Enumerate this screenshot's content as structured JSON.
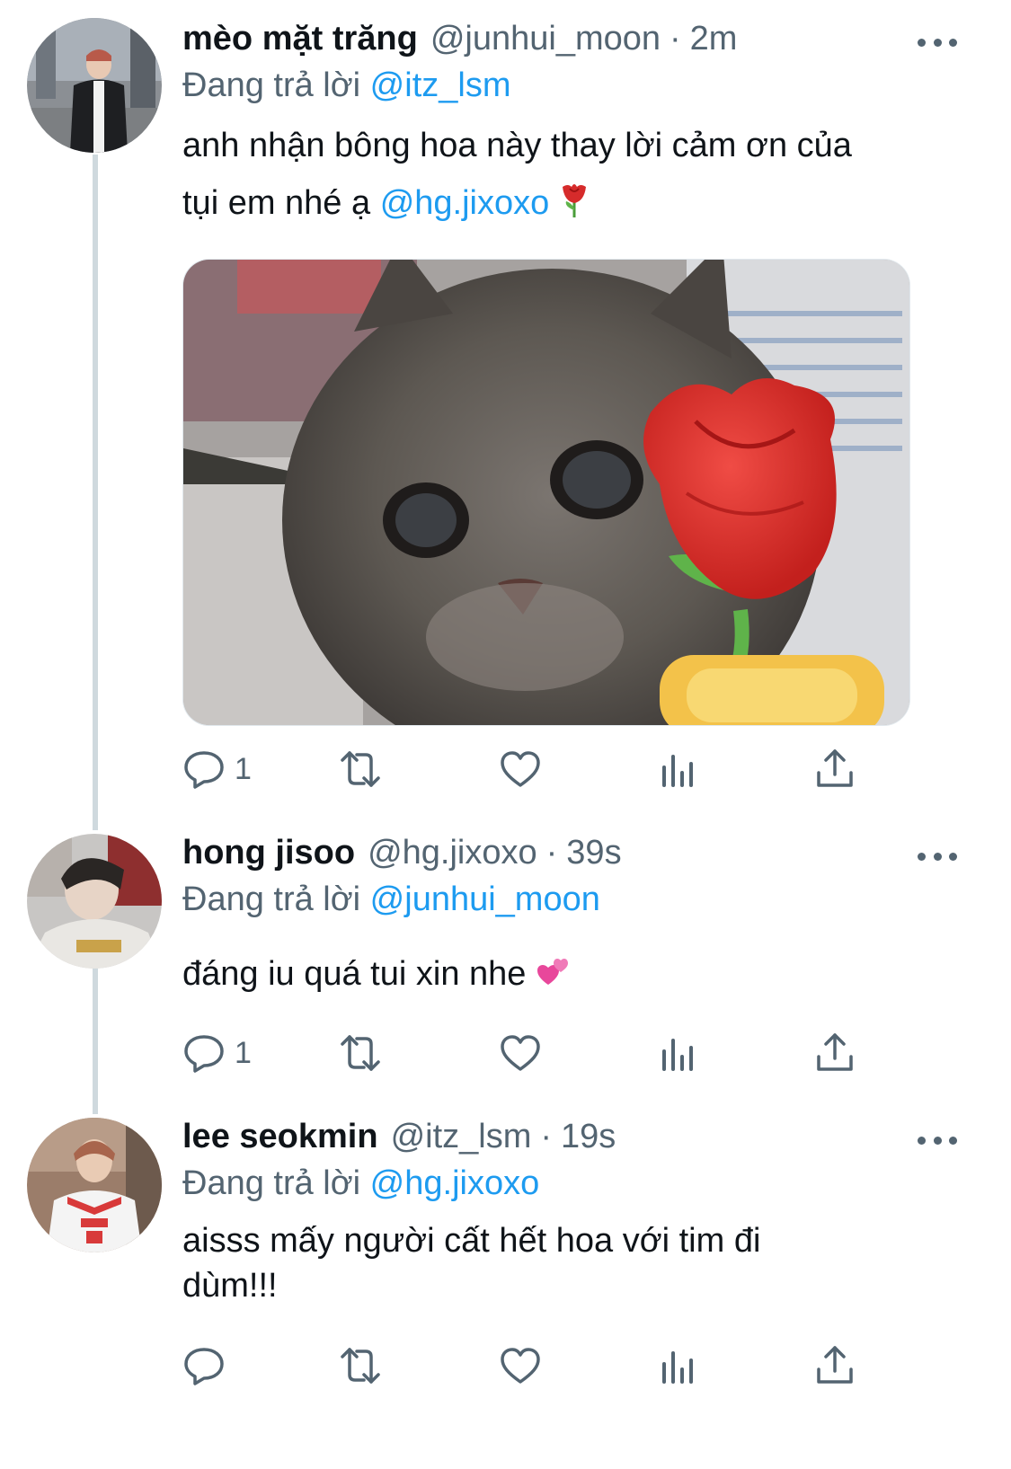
{
  "tweets": [
    {
      "name": "mèo mặt trăng",
      "handle": "@junhui_moon",
      "separator": "·",
      "time": "2m",
      "replying_label": "Đang trả lời",
      "replying_to": "@itz_lsm",
      "text_line1": "anh nhận bông hoa này thay lời cảm ơn của",
      "text_line2_pre": "tụi em nhé ạ",
      "text_mention": "@hg.jixoxo",
      "emoji": "rose-emoji",
      "reply_count": "1",
      "avatar": "avatar-photo"
    },
    {
      "name": "hong jisoo",
      "handle": "@hg.jixoxo",
      "separator": "·",
      "time": "39s",
      "replying_label": "Đang trả lời",
      "replying_to": "@junhui_moon",
      "text": "đáng iu quá tui xin nhe",
      "emoji": "two-hearts-emoji",
      "reply_count": "1",
      "avatar": "avatar-photo"
    },
    {
      "name": "lee seokmin",
      "handle": "@itz_lsm",
      "separator": "·",
      "time": "19s",
      "replying_label": "Đang trả lời",
      "replying_to": "@hg.jixoxo",
      "text_line1": "aisss mấy người cất hết hoa với tim đi",
      "text_line2": "dùm!!!",
      "reply_count": "",
      "avatar": "avatar-photo"
    }
  ],
  "colors": {
    "link": "#1d9bf0",
    "secondary": "#536471",
    "primary_text": "#0f1419",
    "thread_line": "#cfd9de"
  },
  "icons": [
    "reply-icon",
    "retweet-icon",
    "like-icon",
    "analytics-icon",
    "share-icon",
    "more-icon"
  ]
}
